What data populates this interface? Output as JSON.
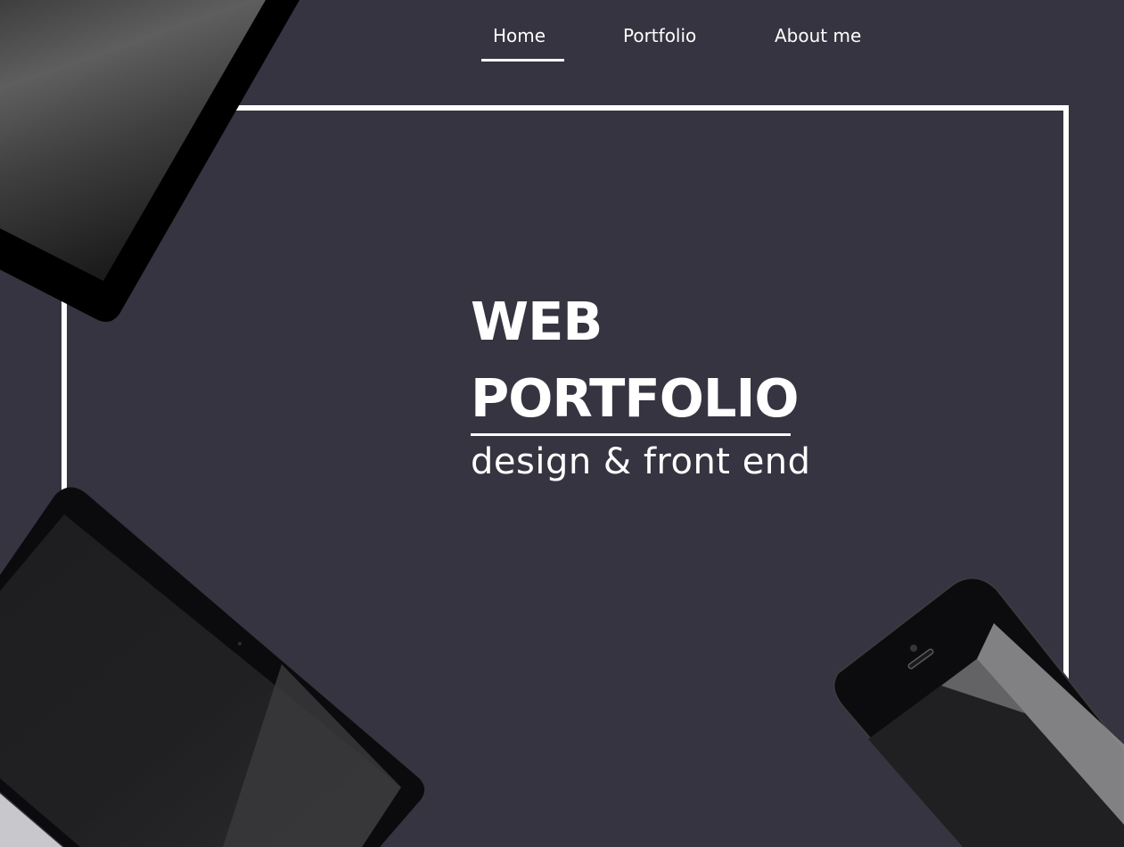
{
  "nav": {
    "items": [
      {
        "label": "Home",
        "active": true
      },
      {
        "label": "Portfolio",
        "active": false
      },
      {
        "label": "About me",
        "active": false
      }
    ]
  },
  "hero": {
    "title_line1": "WEB",
    "title_line2": "PORTFOLIO",
    "subtitle": "design & front end"
  },
  "colors": {
    "background": "#353440",
    "accent": "#ffffff",
    "device_frame": "#0d0d0f"
  },
  "decorations": {
    "top_left": "tablet-icon",
    "bottom_left": "tablet-icon",
    "bottom_right": "smartphone-icon"
  }
}
